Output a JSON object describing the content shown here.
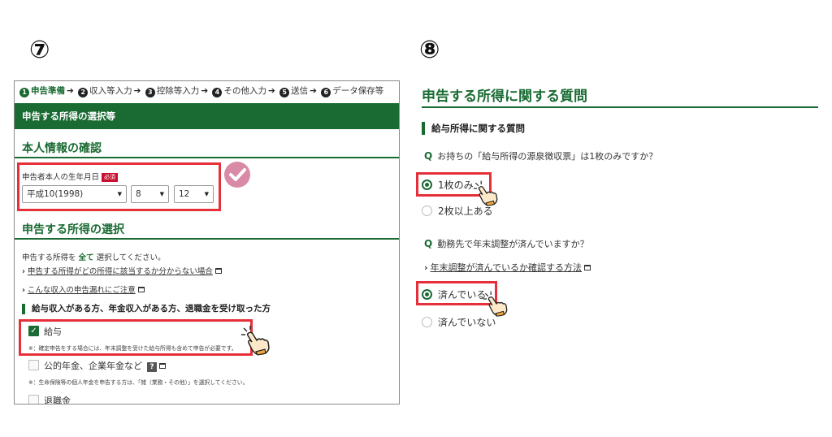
{
  "labels": {
    "seven": "⑦",
    "eight": "⑧"
  },
  "left": {
    "steps": [
      {
        "num": "1",
        "label": "申告準備",
        "current": true
      },
      {
        "num": "2",
        "label": "収入等入力"
      },
      {
        "num": "3",
        "label": "控除等入力"
      },
      {
        "num": "4",
        "label": "その他入力"
      },
      {
        "num": "5",
        "label": "送信"
      },
      {
        "num": "6",
        "label": "データ保存等"
      }
    ],
    "step_arrow": "➔",
    "header_bar": "申告する所得の選択等",
    "section1_title": "本人情報の確認",
    "birth_label": "申告者本人の生年月日",
    "required_badge": "必須",
    "birth_year": "平成10(1998)",
    "birth_month": "8",
    "birth_day": "12",
    "section2_title": "申告する所得の選択",
    "instruction_pre": "申告する所得を ",
    "instruction_bold": "全て",
    "instruction_post": " 選択してください。",
    "link1": "申告する所得がどの所得に該当するか分からない場合",
    "link2": "こんな収入の申告漏れにご注意",
    "subheading": "給与収入がある方、年金収入がある方、退職金を受け取った方",
    "item1": "給与",
    "item1_checked": true,
    "note1": "※：確定申告をする場合には、年末調整を受けた給与所得も含めて申告が必要です。",
    "item2": "公的年金、企業年金など",
    "item2_help": "?",
    "note2": "※：生命保険等の個人年金を申告する方は、「雑（業務・その他）」を選択してください。",
    "item3": "退職金"
  },
  "right": {
    "title": "申告する所得に関する質問",
    "subheading": "給与所得に関する質問",
    "q_mark": "Q",
    "q1": "お持ちの「給与所得の源泉徴収票」は1枚のみですか？",
    "q1_options": [
      "1枚のみ",
      "2枚以上ある"
    ],
    "q1_selected": "1枚のみ",
    "q2": "勤務先で年末調整が済んでいますか？",
    "q2_link": "年末調整が済んでいるか確認する方法",
    "q2_options": [
      "済んでいる",
      "済んでいない"
    ],
    "q2_selected": "済んでいる"
  },
  "colors": {
    "green": "#1a6b33",
    "highlight_red": "#e53039",
    "required_red": "#c8102e",
    "check_pink": "#d98aa6"
  },
  "icons": [
    "external-window-icon",
    "pointing-hand-icon",
    "check-circle-icon",
    "chevron-right-icon",
    "dropdown-caret-icon"
  ]
}
